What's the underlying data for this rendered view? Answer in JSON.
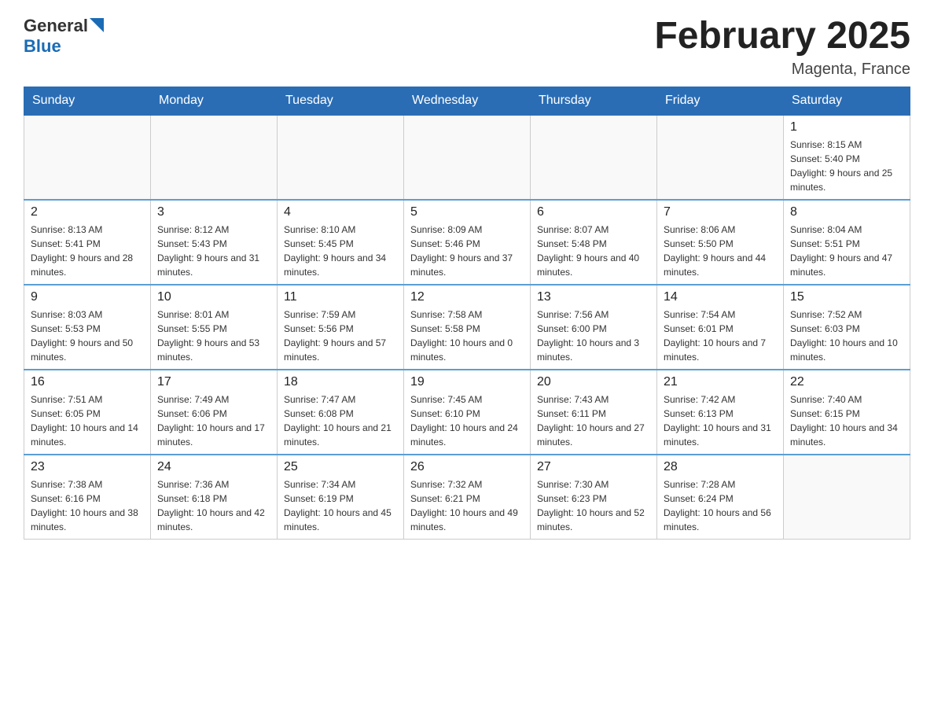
{
  "logo": {
    "text_general": "General",
    "text_blue": "Blue"
  },
  "title": {
    "month_year": "February 2025",
    "location": "Magenta, France"
  },
  "days_of_week": [
    "Sunday",
    "Monday",
    "Tuesday",
    "Wednesday",
    "Thursday",
    "Friday",
    "Saturday"
  ],
  "weeks": [
    [
      {
        "day": "",
        "info": ""
      },
      {
        "day": "",
        "info": ""
      },
      {
        "day": "",
        "info": ""
      },
      {
        "day": "",
        "info": ""
      },
      {
        "day": "",
        "info": ""
      },
      {
        "day": "",
        "info": ""
      },
      {
        "day": "1",
        "info": "Sunrise: 8:15 AM\nSunset: 5:40 PM\nDaylight: 9 hours and 25 minutes."
      }
    ],
    [
      {
        "day": "2",
        "info": "Sunrise: 8:13 AM\nSunset: 5:41 PM\nDaylight: 9 hours and 28 minutes."
      },
      {
        "day": "3",
        "info": "Sunrise: 8:12 AM\nSunset: 5:43 PM\nDaylight: 9 hours and 31 minutes."
      },
      {
        "day": "4",
        "info": "Sunrise: 8:10 AM\nSunset: 5:45 PM\nDaylight: 9 hours and 34 minutes."
      },
      {
        "day": "5",
        "info": "Sunrise: 8:09 AM\nSunset: 5:46 PM\nDaylight: 9 hours and 37 minutes."
      },
      {
        "day": "6",
        "info": "Sunrise: 8:07 AM\nSunset: 5:48 PM\nDaylight: 9 hours and 40 minutes."
      },
      {
        "day": "7",
        "info": "Sunrise: 8:06 AM\nSunset: 5:50 PM\nDaylight: 9 hours and 44 minutes."
      },
      {
        "day": "8",
        "info": "Sunrise: 8:04 AM\nSunset: 5:51 PM\nDaylight: 9 hours and 47 minutes."
      }
    ],
    [
      {
        "day": "9",
        "info": "Sunrise: 8:03 AM\nSunset: 5:53 PM\nDaylight: 9 hours and 50 minutes."
      },
      {
        "day": "10",
        "info": "Sunrise: 8:01 AM\nSunset: 5:55 PM\nDaylight: 9 hours and 53 minutes."
      },
      {
        "day": "11",
        "info": "Sunrise: 7:59 AM\nSunset: 5:56 PM\nDaylight: 9 hours and 57 minutes."
      },
      {
        "day": "12",
        "info": "Sunrise: 7:58 AM\nSunset: 5:58 PM\nDaylight: 10 hours and 0 minutes."
      },
      {
        "day": "13",
        "info": "Sunrise: 7:56 AM\nSunset: 6:00 PM\nDaylight: 10 hours and 3 minutes."
      },
      {
        "day": "14",
        "info": "Sunrise: 7:54 AM\nSunset: 6:01 PM\nDaylight: 10 hours and 7 minutes."
      },
      {
        "day": "15",
        "info": "Sunrise: 7:52 AM\nSunset: 6:03 PM\nDaylight: 10 hours and 10 minutes."
      }
    ],
    [
      {
        "day": "16",
        "info": "Sunrise: 7:51 AM\nSunset: 6:05 PM\nDaylight: 10 hours and 14 minutes."
      },
      {
        "day": "17",
        "info": "Sunrise: 7:49 AM\nSunset: 6:06 PM\nDaylight: 10 hours and 17 minutes."
      },
      {
        "day": "18",
        "info": "Sunrise: 7:47 AM\nSunset: 6:08 PM\nDaylight: 10 hours and 21 minutes."
      },
      {
        "day": "19",
        "info": "Sunrise: 7:45 AM\nSunset: 6:10 PM\nDaylight: 10 hours and 24 minutes."
      },
      {
        "day": "20",
        "info": "Sunrise: 7:43 AM\nSunset: 6:11 PM\nDaylight: 10 hours and 27 minutes."
      },
      {
        "day": "21",
        "info": "Sunrise: 7:42 AM\nSunset: 6:13 PM\nDaylight: 10 hours and 31 minutes."
      },
      {
        "day": "22",
        "info": "Sunrise: 7:40 AM\nSunset: 6:15 PM\nDaylight: 10 hours and 34 minutes."
      }
    ],
    [
      {
        "day": "23",
        "info": "Sunrise: 7:38 AM\nSunset: 6:16 PM\nDaylight: 10 hours and 38 minutes."
      },
      {
        "day": "24",
        "info": "Sunrise: 7:36 AM\nSunset: 6:18 PM\nDaylight: 10 hours and 42 minutes."
      },
      {
        "day": "25",
        "info": "Sunrise: 7:34 AM\nSunset: 6:19 PM\nDaylight: 10 hours and 45 minutes."
      },
      {
        "day": "26",
        "info": "Sunrise: 7:32 AM\nSunset: 6:21 PM\nDaylight: 10 hours and 49 minutes."
      },
      {
        "day": "27",
        "info": "Sunrise: 7:30 AM\nSunset: 6:23 PM\nDaylight: 10 hours and 52 minutes."
      },
      {
        "day": "28",
        "info": "Sunrise: 7:28 AM\nSunset: 6:24 PM\nDaylight: 10 hours and 56 minutes."
      },
      {
        "day": "",
        "info": ""
      }
    ]
  ]
}
